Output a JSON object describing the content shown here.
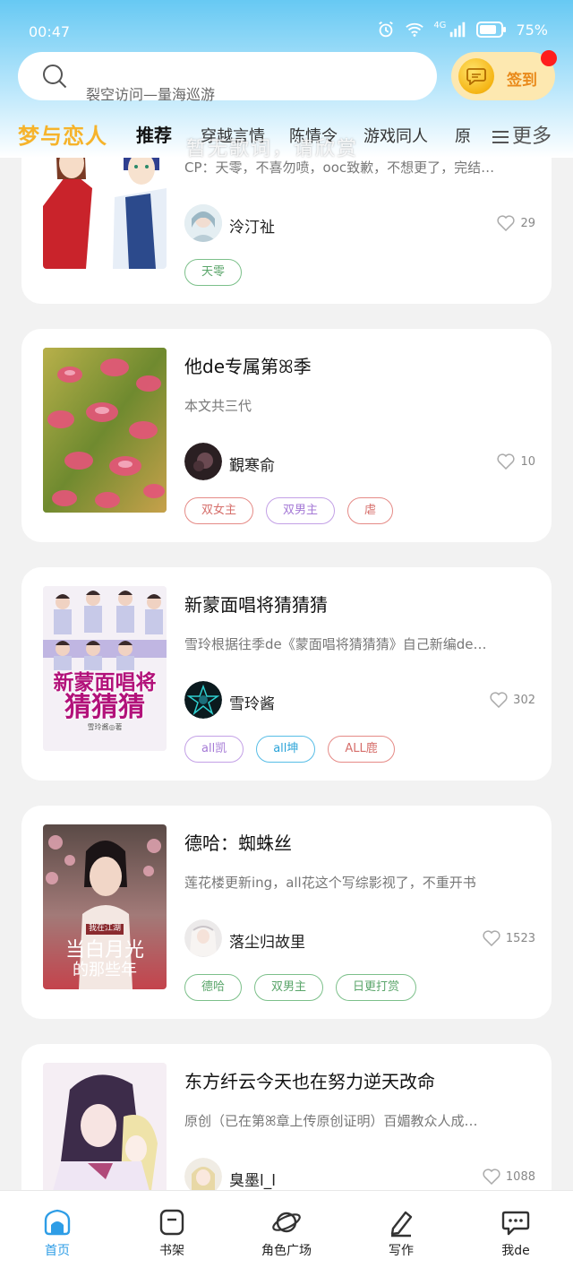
{
  "status_bar": {
    "time": "00:47",
    "network": "4G",
    "battery": "75%"
  },
  "search": {
    "placeholder": "裂空访问—量海巡游"
  },
  "signin": {
    "label": "签到"
  },
  "tabs": {
    "logo": "梦与恋人",
    "items": [
      "推荐",
      "穿越言情",
      "陈情令",
      "游戏同人",
      "原"
    ],
    "more": "更多",
    "overlay_lyric": "暂无歌词，请欣赏"
  },
  "cards": [
    {
      "title": "",
      "desc": "CP：天零，不喜勿喷，ooc致歉，不想更了，完结…",
      "author": "泠汀祉",
      "likes": "29",
      "tags": [
        "天零"
      ]
    },
    {
      "title": "他de专属第ꕤ季",
      "desc": "本文共三代",
      "author": "覲寒俞",
      "likes": "10",
      "tags": [
        "双女主",
        "双男主",
        "虐"
      ]
    },
    {
      "title": "新蒙面唱将猜猜猜",
      "desc": "雪玲根据往季de《蒙面唱将猜猜猜》自己新编de…",
      "author": "雪玲酱",
      "likes": "302",
      "tags": [
        "all凯",
        "all坤",
        "ALL鹿"
      ],
      "cover_text": [
        "新蒙面唱将",
        "猜猜猜",
        "雪玲酱◎著"
      ]
    },
    {
      "title": "德哈：蜘蛛丝",
      "desc": "莲花楼更新ing，all花这个写综影视了，不重开书",
      "author": "落尘归故里",
      "likes": "1523",
      "tags": [
        "德哈",
        "双男主",
        "日更打赏"
      ],
      "cover_text": [
        "我在江湖",
        "当白月光",
        "的那些年"
      ]
    },
    {
      "title": "东方纤云今天也在努力逆天改命",
      "desc": "原创（已在第ꕤ章上传原创证明）百媚教众人成…",
      "author": "臭墨l_l",
      "likes": "1088",
      "tags": []
    }
  ],
  "bottom_nav": [
    "首页",
    "书架",
    "角色广场",
    "写作",
    "我de"
  ],
  "colors": {
    "accent": "#2e9de6",
    "header": "#67c9f3",
    "brand": "#f6b32a"
  }
}
